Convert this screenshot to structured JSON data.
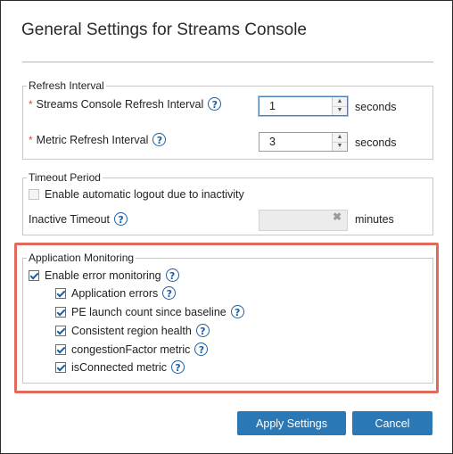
{
  "dialog": {
    "title": "General Settings for Streams Console"
  },
  "refresh_interval": {
    "legend": "Refresh Interval",
    "console_label": "Streams Console Refresh Interval",
    "console_value": "1",
    "metric_label": "Metric Refresh Interval",
    "metric_value": "3",
    "unit": "seconds",
    "required_mark": "*"
  },
  "timeout": {
    "legend": "Timeout Period",
    "logout_label": "Enable automatic logout due to inactivity",
    "logout_checked": false,
    "inactive_label": "Inactive Timeout",
    "inactive_value": "",
    "unit": "minutes",
    "clear_glyph": "✖"
  },
  "monitoring": {
    "legend": "Application Monitoring",
    "enable_label": "Enable error monitoring",
    "items": [
      {
        "label": "Application errors",
        "checked": true
      },
      {
        "label": "PE launch count since baseline",
        "checked": true
      },
      {
        "label": "Consistent region health",
        "checked": true
      },
      {
        "label": "congestionFactor metric",
        "checked": true
      },
      {
        "label": "isConnected metric",
        "checked": true
      }
    ]
  },
  "help_glyph": "?",
  "buttons": {
    "apply": "Apply Settings",
    "cancel": "Cancel"
  },
  "colors": {
    "accent": "#2a79b6",
    "highlight": "#e06b5a",
    "required": "#c8553d",
    "help": "#1f5fa0"
  }
}
